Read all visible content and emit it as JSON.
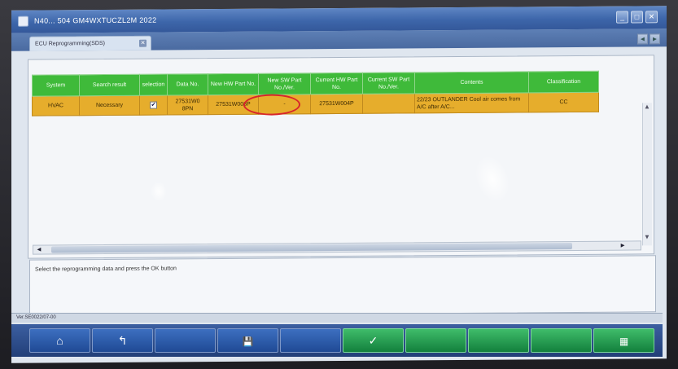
{
  "window": {
    "title": "N40... 504   GM4WXTUCZL2M 2022",
    "controls": [
      "_",
      "□",
      "✕"
    ]
  },
  "tab": {
    "label": "ECU Reprogramming(SDS)",
    "close": "✕"
  },
  "nav": {
    "left": "◄",
    "right": "►"
  },
  "table": {
    "headers": [
      "System",
      "Search result",
      "selection",
      "Data No.",
      "New HW Part No.",
      "New SW Part No./Ver.",
      "Current HW Part No.",
      "Current SW Part No./Ver.",
      "Contents",
      "Classification"
    ],
    "rows": [
      {
        "system": "HVAC",
        "result": "Necessary",
        "selected": "✔",
        "data_no": "27531W0 8PN",
        "new_hw": "27531W008P",
        "new_sw": "-",
        "cur_hw": "27531W004P",
        "cur_sw": "",
        "contents": "22/23 OUTLANDER   Cool air comes from A/C after A/C...",
        "classification": "CC"
      }
    ]
  },
  "scroll": {
    "up": "▲",
    "down": "▼",
    "left": "◄",
    "right": "►"
  },
  "message": "Select the reprogramming data and press the OK button",
  "version": "Ver.SE0022/07-00",
  "toolbar": {
    "home": "⌂",
    "back": "↰",
    "disk": "💾",
    "ok": "✓",
    "last": "▦"
  }
}
